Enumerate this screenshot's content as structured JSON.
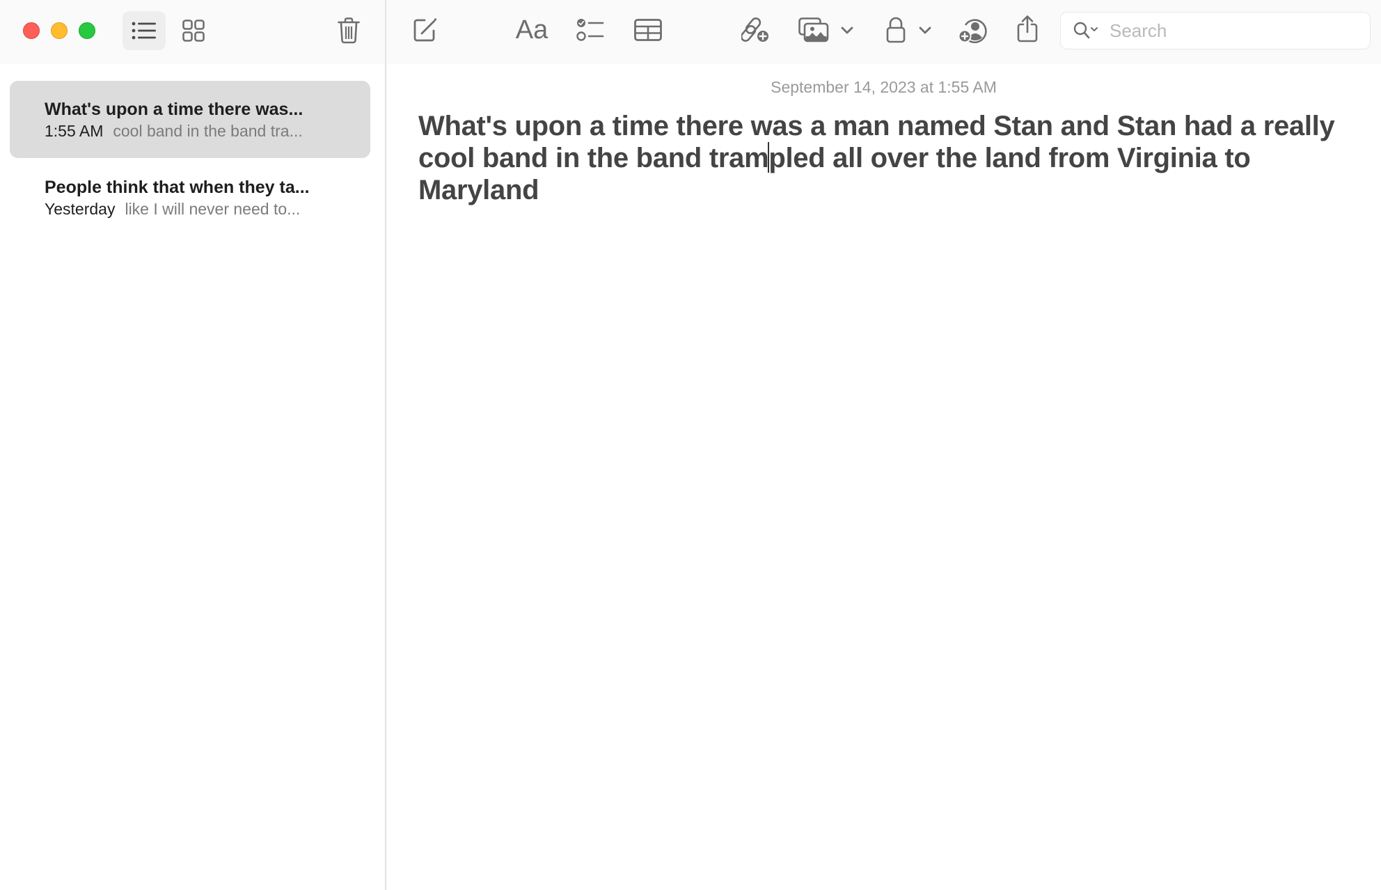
{
  "window": {
    "controls": [
      "close",
      "minimize",
      "maximize"
    ]
  },
  "sidebar_toolbar": {
    "list_view": {
      "icon": "list-icon",
      "active": true
    },
    "gallery_view": {
      "icon": "grid-icon",
      "active": false
    },
    "delete": {
      "icon": "trash-icon"
    }
  },
  "toolbar": {
    "compose": {
      "icon": "compose-icon"
    },
    "format_label": "Aa",
    "checklist": {
      "icon": "checklist-icon"
    },
    "table": {
      "icon": "table-icon"
    },
    "link": {
      "icon": "link-add-icon"
    },
    "media": {
      "icon": "photo-icon",
      "has_dropdown": true
    },
    "lock": {
      "icon": "lock-icon",
      "has_dropdown": true
    },
    "collaborate": {
      "icon": "person-add-icon"
    },
    "share": {
      "icon": "share-icon"
    }
  },
  "search": {
    "placeholder": "Search",
    "value": ""
  },
  "notes": [
    {
      "title": "What's upon a time there was...",
      "date": "1:55 AM",
      "preview": "cool band in the band tra...",
      "selected": true
    },
    {
      "title": "People think that when they ta...",
      "date": "Yesterday",
      "preview": "like I will never need to...",
      "selected": false
    }
  ],
  "editor": {
    "timestamp": "September 14, 2023 at 1:55 AM",
    "body_before_caret": "What's upon a time there was a man named Stan and Stan had a really cool band in the band tram",
    "body_after_caret": "pled all over the land from Virginia to Maryland"
  }
}
